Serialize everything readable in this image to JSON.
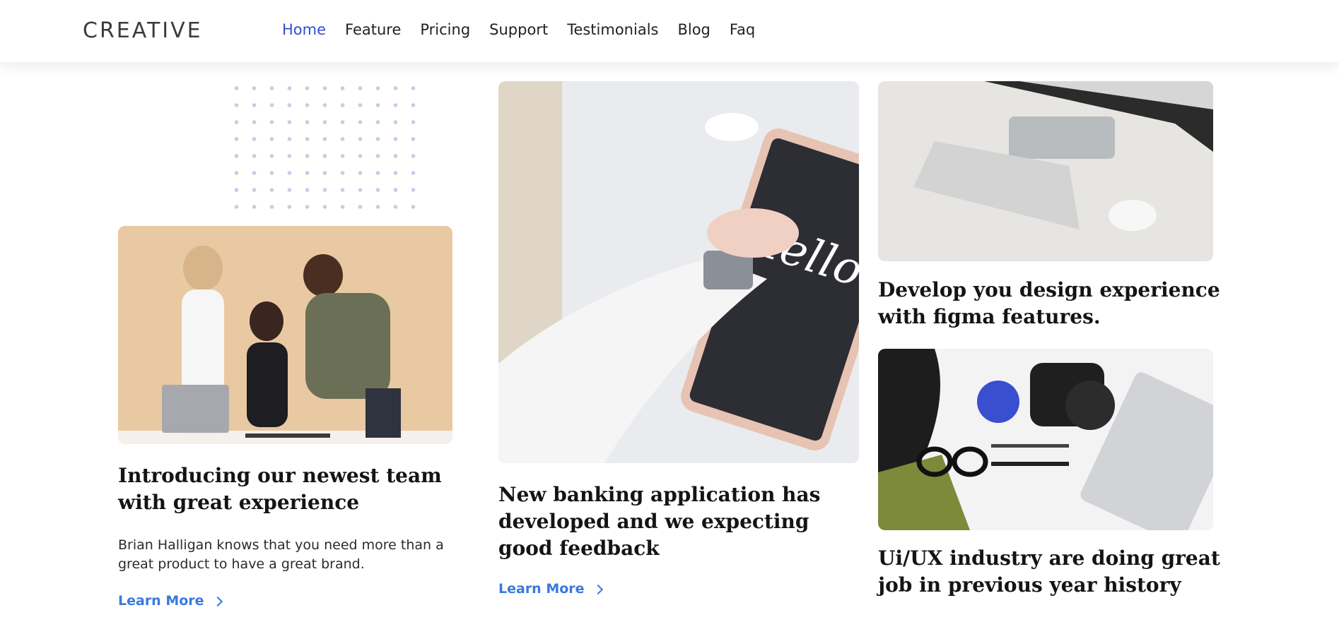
{
  "header": {
    "logo": "CREATIVE",
    "nav": [
      {
        "label": "Home",
        "active": true
      },
      {
        "label": "Feature",
        "active": false
      },
      {
        "label": "Pricing",
        "active": false
      },
      {
        "label": "Support",
        "active": false
      },
      {
        "label": "Testimonials",
        "active": false
      },
      {
        "label": "Blog",
        "active": false
      },
      {
        "label": "Faq",
        "active": false
      }
    ]
  },
  "cards": {
    "team": {
      "title": "Introducing our newest team with great experience",
      "text": "Brian Halligan knows that you need more than a great product to have a great brand.",
      "link": "Learn More"
    },
    "banking": {
      "title": "New banking application has developed and we expecting good feedback",
      "link": "Learn More"
    },
    "figma": {
      "title": "Develop you design experience with figma features."
    },
    "uiux": {
      "title": "Ui/UX industry are doing great job in previous year history"
    }
  },
  "colors": {
    "accent": "#3a78e0",
    "nav_active": "#2f4fd0"
  }
}
